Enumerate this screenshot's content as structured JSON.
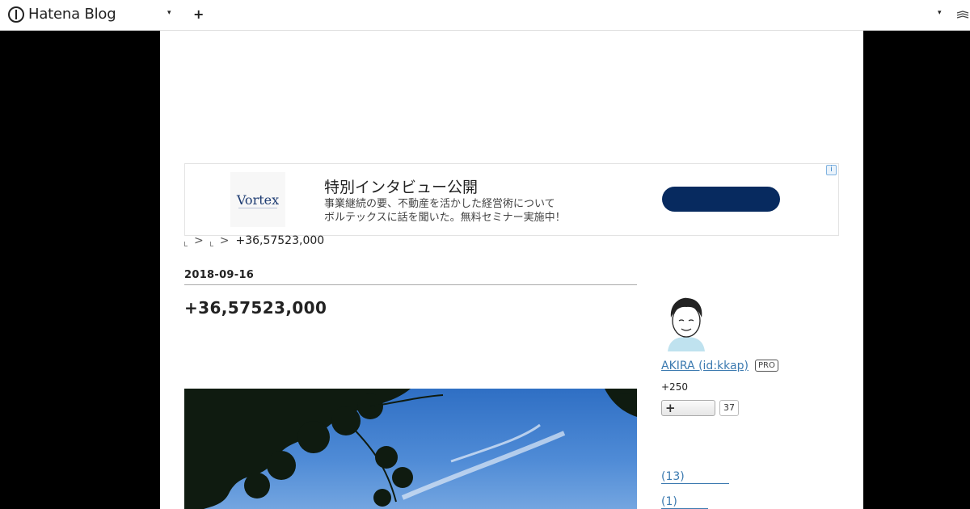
{
  "header": {
    "logo_text": "Hatena Blog",
    "dropdown_glyph": "▾",
    "add_glyph": "+",
    "right_dropdown_glyph": "▾",
    "right_icon": "hatena-mark-icon"
  },
  "ad": {
    "brand": "Vortex",
    "title": "特別インタビュー公開",
    "desc_line1": "事業継続の要、不動産を活かした経営術について",
    "desc_line2": "ボルテックスに話を聞いた。無料セミナー実施中！",
    "info_glyph": "i",
    "cta_color": "#072a5f"
  },
  "breadcrumb": {
    "sep": ">",
    "current": "+36,57523,000"
  },
  "entry": {
    "date": "2018-09-16",
    "title": "+36,57523,000"
  },
  "sidebar": {
    "profile_name": "AKIRA (id:kkap)",
    "pro_badge": "PRO",
    "readers": "+250",
    "subscribe_glyph": "+",
    "subscribe_count": "37",
    "archives": [
      {
        "count": " (13)"
      },
      {
        "count": " (1)"
      }
    ]
  }
}
